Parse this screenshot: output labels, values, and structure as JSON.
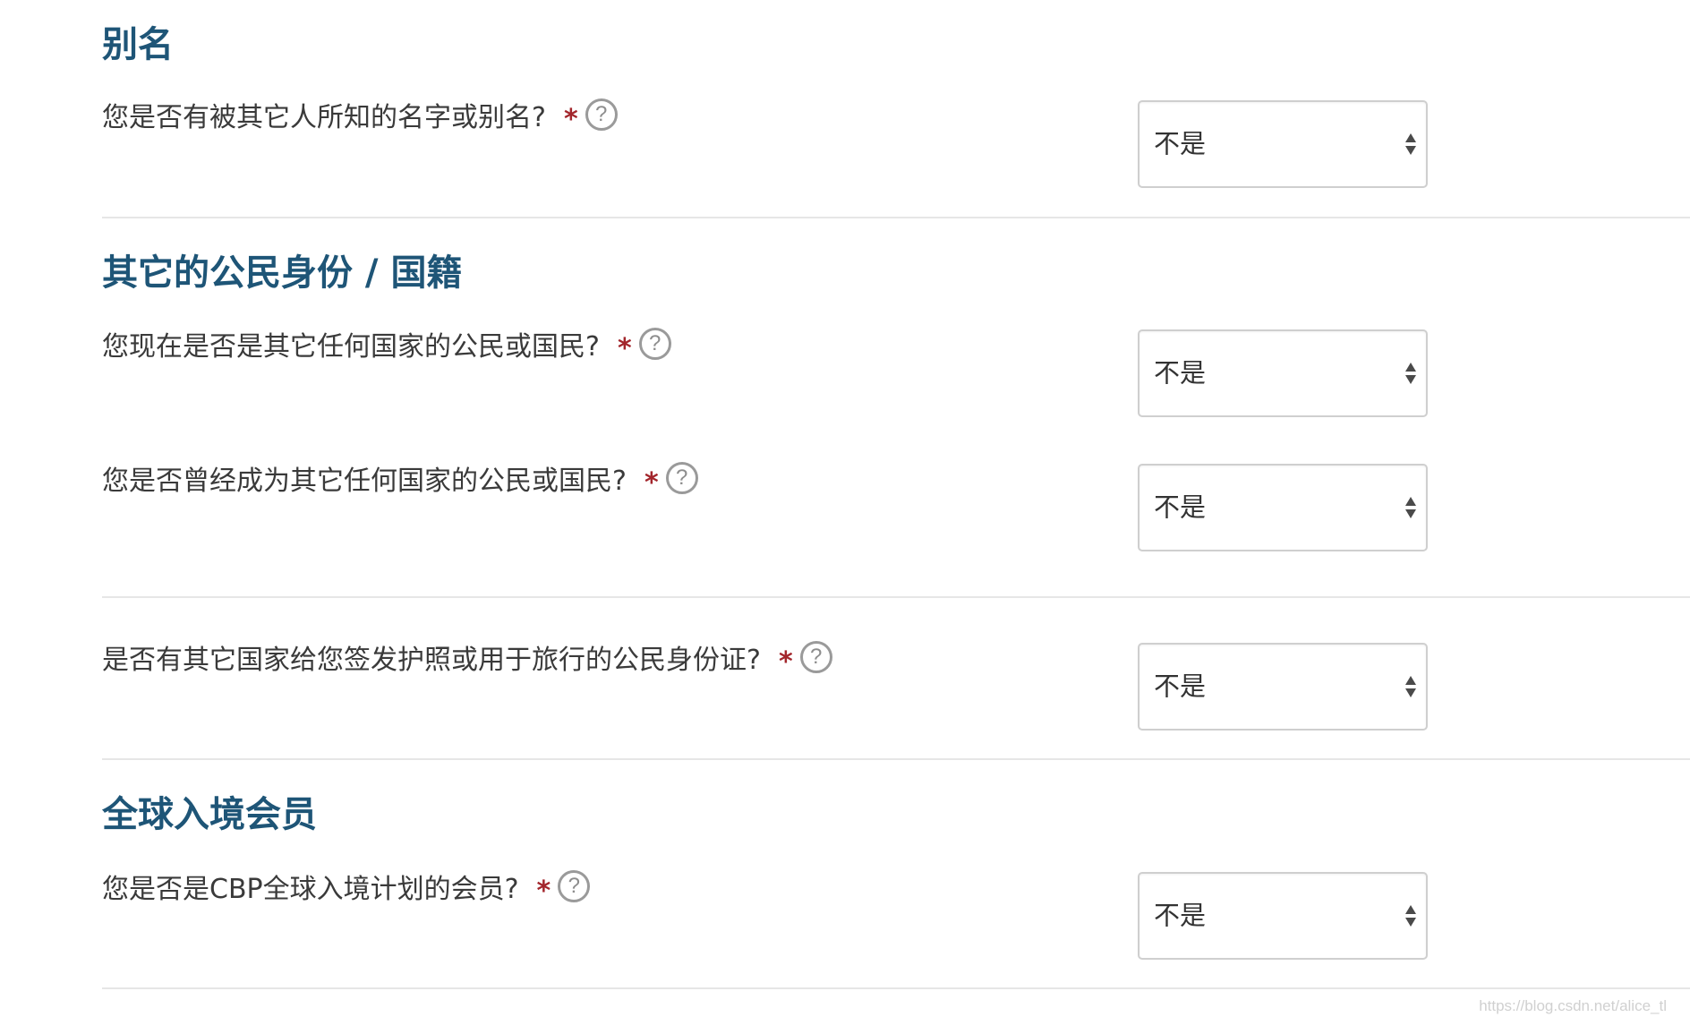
{
  "sections": [
    {
      "title": "别名",
      "questions": [
        {
          "text": "您是否有被其它人所知的名字或别名?",
          "required_mark": "*",
          "help": "?",
          "answer": "不是"
        }
      ]
    },
    {
      "title": "其它的公民身份 / 国籍",
      "questions": [
        {
          "text": "您现在是否是其它任何国家的公民或国民?",
          "required_mark": "*",
          "help": "?",
          "answer": "不是"
        },
        {
          "text": "您是否曾经成为其它任何国家的公民或国民?",
          "required_mark": "*",
          "help": "?",
          "answer": "不是"
        },
        {
          "text": "是否有其它国家给您签发护照或用于旅行的公民身份证?",
          "required_mark": "*",
          "help": "?",
          "answer": "不是"
        }
      ]
    },
    {
      "title": "全球入境会员",
      "questions": [
        {
          "text": "您是否是CBP全球入境计划的会员?",
          "required_mark": "*",
          "help": "?",
          "answer": "不是"
        }
      ]
    }
  ],
  "watermark": "https://blog.csdn.net/alice_tl",
  "colors": {
    "heading": "#1e5577",
    "required": "#a3262c",
    "help_icon": "#9a9a9a",
    "select_border": "#cfcfcf",
    "divider": "#e6e6e6"
  },
  "icons": {
    "help": "question-circle-icon",
    "select": "sort-arrows-icon"
  }
}
